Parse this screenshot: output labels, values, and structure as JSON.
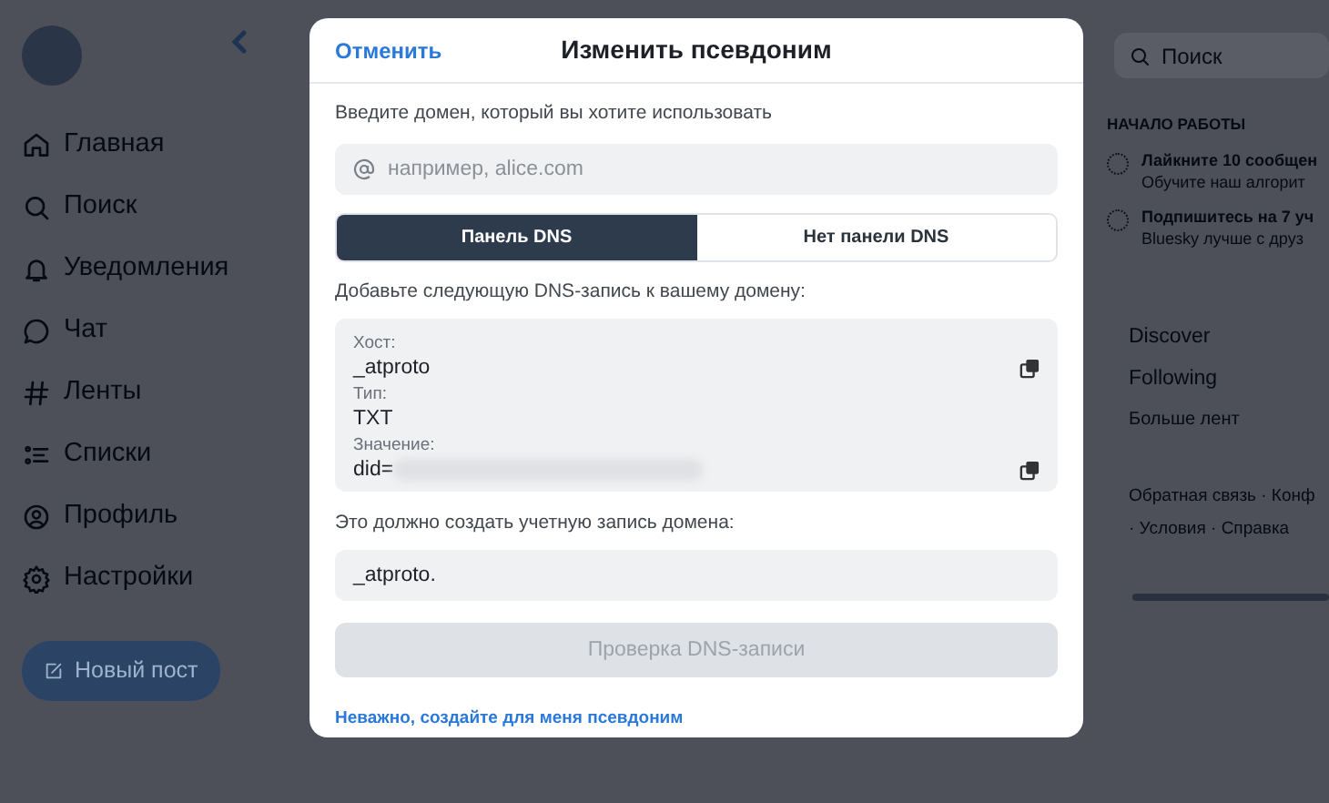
{
  "sidebar": {
    "items": [
      {
        "label": "Главная"
      },
      {
        "label": "Поиск"
      },
      {
        "label": "Уведомления"
      },
      {
        "label": "Чат"
      },
      {
        "label": "Ленты"
      },
      {
        "label": "Списки"
      },
      {
        "label": "Профиль"
      },
      {
        "label": "Настройки"
      }
    ],
    "new_post_button": "Новый пост"
  },
  "right_panel": {
    "search": {
      "placeholder": "Поиск"
    },
    "heading": "НАЧАЛО РАБОТЫ",
    "tasks": [
      {
        "title": "Лайкните 10 сообщен",
        "subtitle": "Обучите наш алгорит"
      },
      {
        "title": "Подпишитесь на 7 уч",
        "subtitle": "Bluesky лучше с друз"
      }
    ],
    "feeds": [
      "Discover",
      "Following",
      "Больше лент"
    ],
    "footer_lines": [
      "Обратная связь · Конф",
      "· Условия · Справка"
    ]
  },
  "modal": {
    "cancel": "Отменить",
    "title": "Изменить псевдоним",
    "domain_label": "Введите домен, который вы хотите использовать",
    "domain_field": {
      "placeholder": "например, alice.com"
    },
    "tabs": [
      {
        "label": "Панель DNS",
        "selected": true
      },
      {
        "label": "Нет панели DNS",
        "selected": false
      }
    ],
    "instruction": "Добавьте следующую DNS-запись к вашему домену:",
    "record": [
      {
        "label": "Хост:",
        "value": "_atproto",
        "copyable": true
      },
      {
        "label": "Тип:",
        "value": "TXT",
        "copyable": false
      },
      {
        "label": "Значение:",
        "value": "did=",
        "copyable": true,
        "blurred": true
      }
    ],
    "result_label": "Это должно создать учетную запись домена:",
    "result_value": "_atproto.",
    "verify_button": {
      "label": "Проверка DNS-записи",
      "disabled": true
    },
    "fallback_link": "Неважно, создайте для меня псевдоним"
  }
}
